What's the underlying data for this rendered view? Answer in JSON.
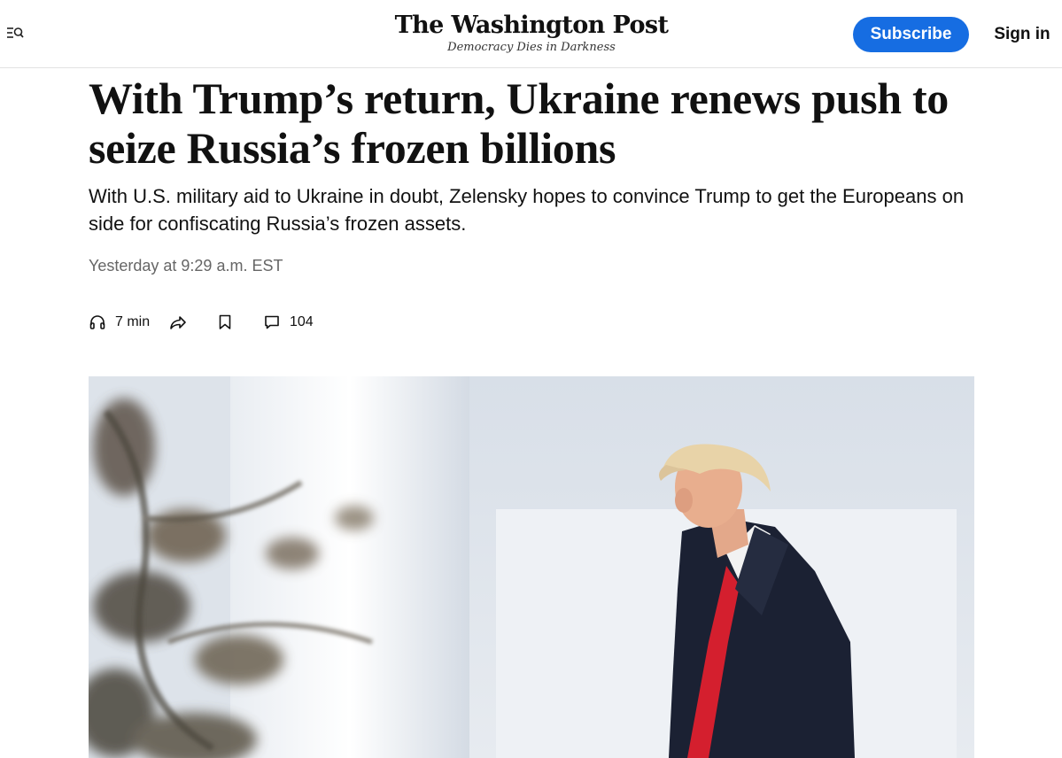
{
  "header": {
    "menu_icon": "menu-search-icon",
    "logo": "The Washington Post",
    "tagline": "Democracy Dies in Darkness",
    "subscribe_label": "Subscribe",
    "signin_label": "Sign in",
    "accent_color": "#166de2"
  },
  "article": {
    "headline": "With Trump’s return, Ukraine renews push to seize Russia’s frozen billions",
    "dek": "With U.S. military aid to Ukraine in doubt, Zelensky hopes to convince Trump to get the Europeans on side for confiscating Russia’s frozen assets.",
    "timestamp": "Yesterday at 9:29 a.m. EST"
  },
  "toolbar": {
    "listen": {
      "icon": "headphones-icon",
      "label": "7 min"
    },
    "share": {
      "icon": "share-icon"
    },
    "save": {
      "icon": "bookmark-icon"
    },
    "comments": {
      "icon": "comment-icon",
      "count": "104"
    }
  },
  "hero": {
    "icon": "photo-trump-at-white-house-colonnade"
  }
}
